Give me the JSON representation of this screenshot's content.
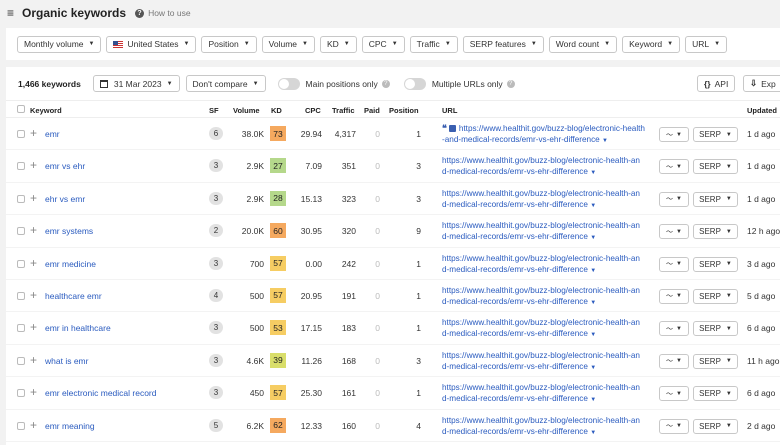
{
  "header": {
    "title": "Organic keywords",
    "how_to": "How to use"
  },
  "filters": [
    "Monthly volume",
    "United States",
    "Position",
    "Volume",
    "KD",
    "CPC",
    "Traffic",
    "SERP features",
    "Word count",
    "Keyword",
    "URL"
  ],
  "toolbar": {
    "count": "1,466 keywords",
    "date": "31 Mar 2023",
    "compare": "Don't compare",
    "main_positions": "Main positions only",
    "multiple_urls": "Multiple URLs only",
    "api": "API",
    "export": "Exp"
  },
  "columns": {
    "keyword": "Keyword",
    "sf": "SF",
    "volume": "Volume",
    "kd": "KD",
    "cpc": "CPC",
    "traffic": "Traffic",
    "paid": "Paid",
    "position": "Position",
    "url": "URL",
    "updated": "Updated"
  },
  "url_line1": "https://www.healthit.gov/buzz-blog/electronic-health-an",
  "url_line2": "d-medical-records/emr-vs-ehr-difference",
  "url_first_line1": "https://www.healthit.gov/buzz-blog/electronic-health",
  "url_first_line2": "-and-medical-records/emr-vs-ehr-difference",
  "serp_label": "SERP",
  "kd_colors": {
    "orange": "#f5a95f",
    "green": "#b5d88b",
    "yellow": "#f6cd63"
  },
  "rows": [
    {
      "keyword": "emr",
      "sf": "6",
      "volume": "38.0K",
      "kd": "73",
      "kd_color": "#f5a95f",
      "cpc": "29.94",
      "traffic": "4,317",
      "paid": "0",
      "position": "1",
      "updated": "1 d ago"
    },
    {
      "keyword": "emr vs ehr",
      "sf": "3",
      "volume": "2.9K",
      "kd": "27",
      "kd_color": "#b5d88b",
      "cpc": "7.09",
      "traffic": "351",
      "paid": "0",
      "position": "3",
      "updated": "1 d ago"
    },
    {
      "keyword": "ehr vs emr",
      "sf": "3",
      "volume": "2.9K",
      "kd": "28",
      "kd_color": "#b5d88b",
      "cpc": "15.13",
      "traffic": "323",
      "paid": "0",
      "position": "3",
      "updated": "1 d ago"
    },
    {
      "keyword": "emr systems",
      "sf": "2",
      "volume": "20.0K",
      "kd": "60",
      "kd_color": "#f5a95f",
      "cpc": "30.95",
      "traffic": "320",
      "paid": "0",
      "position": "9",
      "updated": "12 h ago"
    },
    {
      "keyword": "emr medicine",
      "sf": "3",
      "volume": "700",
      "kd": "57",
      "kd_color": "#f6cd63",
      "cpc": "0.00",
      "traffic": "242",
      "paid": "0",
      "position": "1",
      "updated": "3 d ago"
    },
    {
      "keyword": "healthcare emr",
      "sf": "4",
      "volume": "500",
      "kd": "57",
      "kd_color": "#f6cd63",
      "cpc": "20.95",
      "traffic": "191",
      "paid": "0",
      "position": "1",
      "updated": "5 d ago"
    },
    {
      "keyword": "emr in healthcare",
      "sf": "3",
      "volume": "500",
      "kd": "53",
      "kd_color": "#f6cd63",
      "cpc": "17.15",
      "traffic": "183",
      "paid": "0",
      "position": "1",
      "updated": "6 d ago"
    },
    {
      "keyword": "what is emr",
      "sf": "3",
      "volume": "4.6K",
      "kd": "39",
      "kd_color": "#d9de6a",
      "cpc": "11.26",
      "traffic": "168",
      "paid": "0",
      "position": "3",
      "updated": "11 h ago"
    },
    {
      "keyword": "emr electronic medical record",
      "sf": "3",
      "volume": "450",
      "kd": "57",
      "kd_color": "#f6cd63",
      "cpc": "25.30",
      "traffic": "161",
      "paid": "0",
      "position": "1",
      "updated": "6 d ago"
    },
    {
      "keyword": "emr meaning",
      "sf": "5",
      "volume": "6.2K",
      "kd": "62",
      "kd_color": "#f5a95f",
      "cpc": "12.33",
      "traffic": "160",
      "paid": "0",
      "position": "4",
      "updated": "2 d ago"
    }
  ]
}
